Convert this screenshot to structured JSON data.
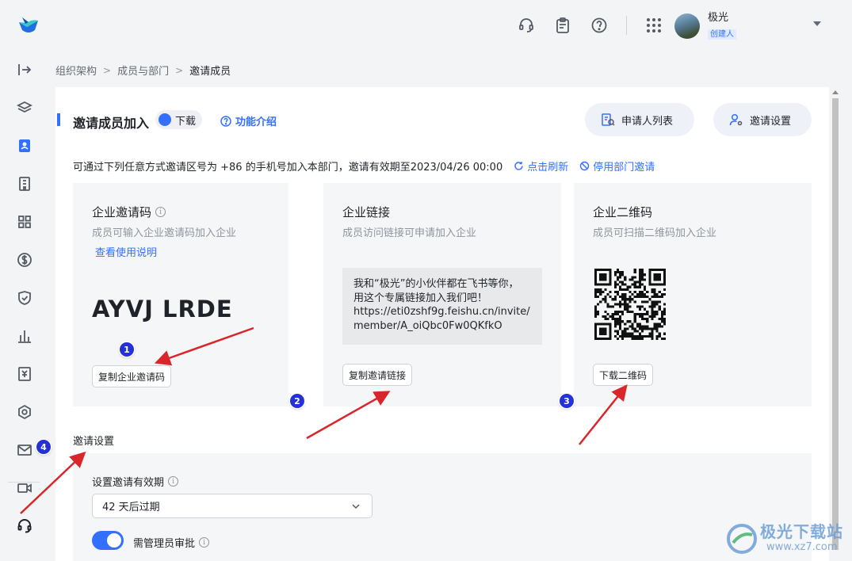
{
  "topbar": {
    "user_name": "极光",
    "user_role": "创建人",
    "icons": [
      "logo-icon",
      "headset-icon",
      "clipboard-icon",
      "help-icon",
      "apps-grid-icon",
      "avatar",
      "chevron-down-icon"
    ]
  },
  "sidebar": {
    "icons": [
      "collapse-icon",
      "layers-icon",
      "contacts-icon",
      "building-icon",
      "apps-icon",
      "billing-icon",
      "security-icon",
      "analytics-icon",
      "approval-icon",
      "settings-icon",
      "mail-icon",
      "video-icon",
      "support-icon"
    ]
  },
  "breadcrumb": [
    "组织架构",
    "成员与部门",
    "邀请成员"
  ],
  "header": {
    "title": "邀请成员加入",
    "download_tag": "下载",
    "intro_link": "功能介绍",
    "applicant_list": "申请人列表",
    "invite_settings": "邀请设置"
  },
  "info": {
    "text": "可通过下列任意方式邀请区号为 +86 的手机号加入本部门，邀请有效期至2023/04/26 00:00",
    "refresh": "点击刷新",
    "disable": "停用部门邀请"
  },
  "cards": {
    "code": {
      "title": "企业邀请码",
      "subtitle": "成员可输入企业邀请码加入企业",
      "help_link": "查看使用说明",
      "value": "AYVJ LRDE",
      "button": "复制企业邀请码"
    },
    "link": {
      "title": "企业链接",
      "subtitle": "成员访问链接可申请加入企业",
      "message": "我和“极光”的小伙伴都在飞书等你，\n用这个专属链接加入我们吧！\nhttps://eti0zshf9g.feishu.cn/invite/\nmember/A_oiQbc0Fw0QKfkO",
      "button": "复制邀请链接"
    },
    "qr": {
      "title": "企业二维码",
      "subtitle": "成员可扫描二维码加入企业",
      "button": "下载二维码"
    }
  },
  "settings": {
    "section_title": "邀请设置",
    "validity_label": "设置邀请有效期",
    "validity_value": "42 天后过期",
    "approval_label": "需管理员审批",
    "approval_on": true
  },
  "annotations": [
    "1",
    "2",
    "3",
    "4"
  ],
  "watermark": {
    "text": "极光下载站",
    "url": "www.xz7.com"
  },
  "colors": {
    "accent": "#3370ff",
    "arrow": "#d9262a",
    "badge": "#2431d6"
  }
}
